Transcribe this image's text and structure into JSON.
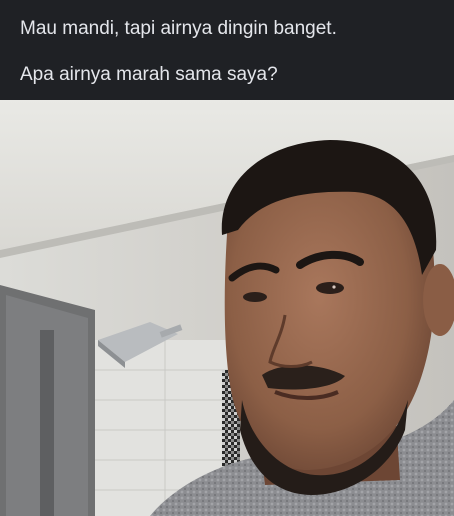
{
  "post": {
    "caption_line_1": "Mau mandi, tapi airnya dingin banget.",
    "caption_line_2": "Apa airnya marah sama saya?"
  },
  "colors": {
    "background": "#1f2125",
    "caption_text": "#e4e6eb"
  }
}
